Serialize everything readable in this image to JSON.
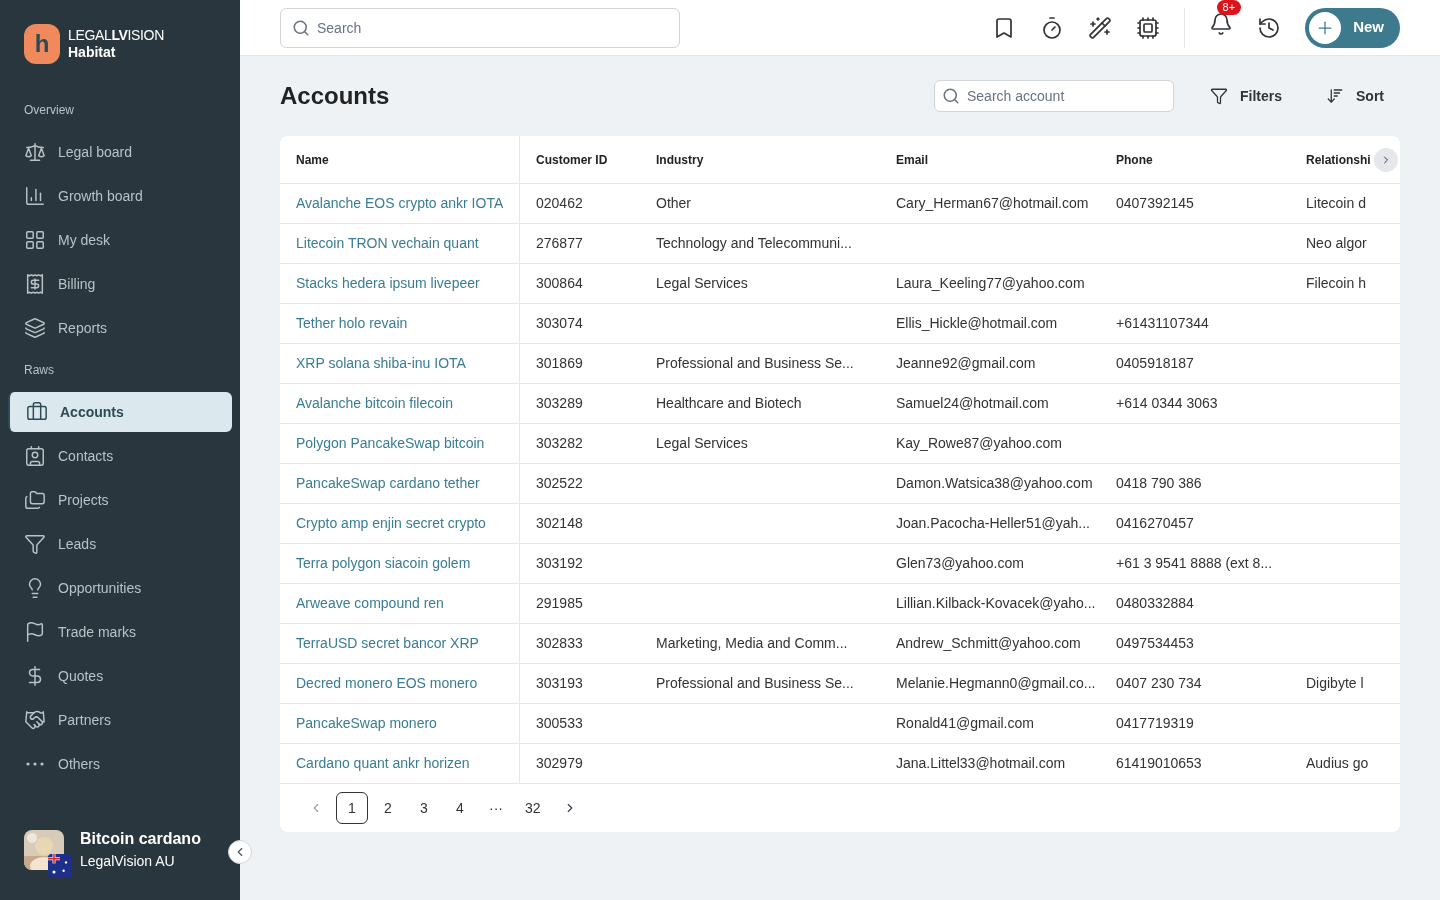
{
  "brand": {
    "logo_letter": "h",
    "wordmark_light": "LEGAL",
    "wordmark_bold": "LV",
    "wordmark_rest": "ISION",
    "product": "Habitat"
  },
  "sidebar": {
    "sections": [
      {
        "title": "Overview",
        "items": [
          {
            "label": "Legal board",
            "selected": false
          },
          {
            "label": "Growth board",
            "selected": false
          },
          {
            "label": "My desk",
            "selected": false
          },
          {
            "label": "Billing",
            "selected": false
          },
          {
            "label": "Reports",
            "selected": false
          }
        ]
      },
      {
        "title": "Raws",
        "items": [
          {
            "label": "Accounts",
            "selected": true
          },
          {
            "label": "Contacts",
            "selected": false
          },
          {
            "label": "Projects",
            "selected": false
          },
          {
            "label": "Leads",
            "selected": false
          },
          {
            "label": "Opportunities",
            "selected": false
          },
          {
            "label": "Trade marks",
            "selected": false
          },
          {
            "label": "Quotes",
            "selected": false
          },
          {
            "label": "Partners",
            "selected": false
          },
          {
            "label": "Others",
            "selected": false
          }
        ]
      }
    ],
    "user": {
      "name": "Bitcoin cardano",
      "org": "LegalVision AU"
    }
  },
  "topbar": {
    "search": {
      "placeholder": "Search"
    },
    "notification_badge": "8+",
    "new_button": "New"
  },
  "page": {
    "title": "Accounts",
    "search": {
      "placeholder": "Search account"
    },
    "filters_button": "Filters",
    "sort_button": "Sort"
  },
  "table": {
    "columns": [
      "Name",
      "Customer ID",
      "Industry",
      "Email",
      "Phone",
      "Relationshi"
    ],
    "rows": [
      [
        "Avalanche EOS crypto ankr IOTA",
        "020462",
        "Other",
        "Cary_Herman67@hotmail.com",
        "0407392145",
        "Litecoin d"
      ],
      [
        "Litecoin TRON vechain quant",
        "276877",
        "Technology and Telecommuni...",
        "",
        "",
        "Neo algor"
      ],
      [
        "Stacks hedera ipsum livepeer",
        "300864",
        "Legal Services",
        "Laura_Keeling77@yahoo.com",
        "",
        "Filecoin h"
      ],
      [
        "Tether holo revain",
        "303074",
        "",
        "Ellis_Hickle@hotmail.com",
        "+61431107344",
        ""
      ],
      [
        "XRP solana shiba-inu IOTA",
        "301869",
        "Professional and Business Se...",
        "Jeanne92@gmail.com",
        "0405918187",
        ""
      ],
      [
        "Avalanche bitcoin filecoin",
        "303289",
        "Healthcare and Biotech",
        "Samuel24@hotmail.com",
        "+614 0344 3063",
        ""
      ],
      [
        "Polygon PancakeSwap bitcoin",
        "303282",
        "Legal Services",
        "Kay_Rowe87@yahoo.com",
        "",
        ""
      ],
      [
        "PancakeSwap cardano tether",
        "302522",
        "",
        "Damon.Watsica38@yahoo.com",
        "0418 790 386",
        ""
      ],
      [
        "Crypto amp enjin secret crypto",
        "302148",
        "",
        "Joan.Pacocha-Heller51@yah...",
        "0416270457",
        ""
      ],
      [
        "Terra polygon siacoin golem",
        "303192",
        "",
        "Glen73@yahoo.com",
        "+61 3 9541 8888 (ext 8...",
        ""
      ],
      [
        "Arweave compound ren",
        "291985",
        "",
        "Lillian.Kilback-Kovacek@yaho...",
        "0480332884",
        ""
      ],
      [
        "TerraUSD secret bancor XRP",
        "302833",
        "Marketing, Media and Comm...",
        "Andrew_Schmitt@yahoo.com",
        "0497534453",
        ""
      ],
      [
        "Decred monero EOS monero",
        "303193",
        "Professional and Business Se...",
        "Melanie.Hegmann0@gmail.co...",
        "0407 230 734",
        "Digibyte l"
      ],
      [
        "PancakeSwap monero",
        "300533",
        "",
        "Ronald41@gmail.com",
        "0417719319",
        ""
      ],
      [
        "Cardano quant ankr horizen",
        "302979",
        "",
        "Jana.Littel33@hotmail.com",
        "61419010653",
        "Audius go"
      ]
    ]
  },
  "pagination": {
    "pages": [
      {
        "label": "1",
        "selected": true
      },
      {
        "label": "2",
        "selected": false
      },
      {
        "label": "3",
        "selected": false
      },
      {
        "label": "4",
        "selected": false
      },
      {
        "label": "···",
        "selected": false
      },
      {
        "label": "32",
        "selected": false
      }
    ]
  }
}
